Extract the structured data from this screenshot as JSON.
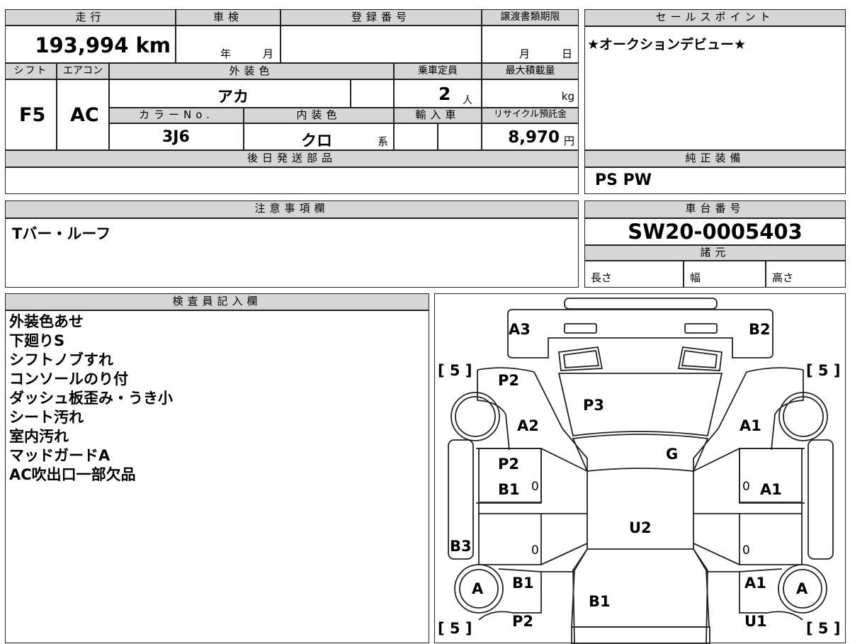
{
  "vehicle": {
    "mileage_label": "走行",
    "mileage_value": "193,994 km",
    "inspection_label": "車検",
    "inspection_year": "年",
    "inspection_month": "月",
    "registration_label": "登録番号",
    "transfer_label": "譲渡書類期限",
    "transfer_month": "月",
    "transfer_day": "日",
    "shift_label": "シフト",
    "shift_value": "F5",
    "ac_label": "エアコン",
    "ac_value": "AC",
    "exterior_label": "外装色",
    "exterior_value": "アカ",
    "capacity_label": "乗車定員",
    "capacity_value": "2",
    "capacity_unit": "人",
    "maxload_label": "最大積載量",
    "maxload_unit": "kg",
    "color_no_label": "カラーNo.",
    "color_no_value": "3J6",
    "interior_label": "内装色",
    "interior_value": "クロ",
    "interior_unit": "系",
    "import_label": "輸入車",
    "recycle_label": "リサイクル預託金",
    "recycle_value": "8,970",
    "recycle_unit": "円"
  },
  "later_parts_label": "後日発送部品",
  "sales_point": {
    "label": "セールスポイント",
    "value": "★オークションデビュー★"
  },
  "equipment": {
    "label": "純正装備",
    "value": "PS PW"
  },
  "notes_box": {
    "label": "注意事項欄",
    "value": "Tバー・ルーフ"
  },
  "chassis": {
    "label": "車台番号",
    "value": "SW20-0005403",
    "spec_label": "諸元",
    "length_label": "長さ",
    "width_label": "幅",
    "height_label": "高さ"
  },
  "inspector": {
    "label": "検査員記入欄",
    "lines": [
      "外装色あせ",
      "下廻りS",
      "シフトノブすれ",
      "コンソールのり付",
      "ダッシュ板歪み・うき小",
      "シート汚れ",
      "室内汚れ",
      "マッドガードA",
      "AC吹出口一部欠品"
    ]
  },
  "diagram": {
    "a3": "A3",
    "b2": "B2",
    "tire_fl": "[ 5 ]",
    "tire_fr": "[ 5 ]",
    "p2_a": "P2",
    "p3": "P3",
    "a2": "A2",
    "a1_r": "A1",
    "g": "G",
    "p2_b": "P2",
    "b1_l": "B1",
    "zero_1": "0",
    "zero_2": "0",
    "a1_m": "A1",
    "u2": "U2",
    "b3": "B3",
    "zero_3": "0",
    "zero_4": "0",
    "wheel_l": "A",
    "b1_lw": "B1",
    "b1_c": "B1",
    "a1_lw": "A1",
    "wheel_r": "A",
    "tire_rl": "[ 5 ]",
    "p2_c": "P2",
    "u1": "U1",
    "tire_rr": "[ 5 ]"
  }
}
